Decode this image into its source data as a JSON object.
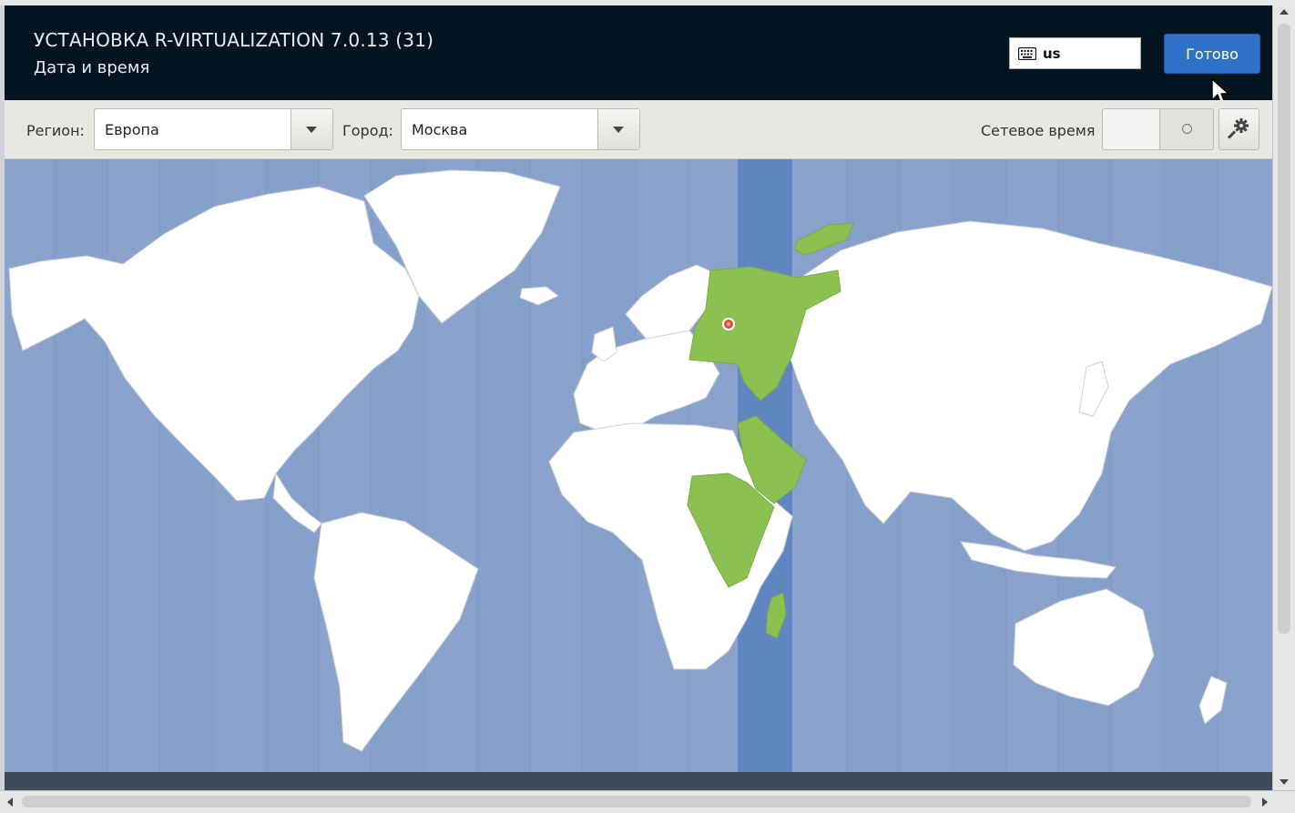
{
  "header": {
    "title": "УСТАНОВКА R-VIRTUALIZATION 7.0.13 (31)",
    "subtitle": "Дата и время",
    "keyboard_layout": "us",
    "done_label": "Готово",
    "done_color": "#2f73c9"
  },
  "toolbar": {
    "region_label": "Регион:",
    "region_value": "Европа",
    "city_label": "Город:",
    "city_value": "Москва",
    "network_time_label": "Сетевое время",
    "network_time_on": false
  },
  "map": {
    "selected_timezone": "Europe/Moscow",
    "ocean_color": "#8aa2cc",
    "land_color": "#ffffff",
    "selected_band_color": "#5f86c0",
    "highlight_color": "#8cc152",
    "marker_color": "#e34b2b"
  },
  "icons": {
    "keyboard": "keyboard-icon",
    "gear": "gear-icon",
    "cursor": "mouse-cursor-icon"
  }
}
